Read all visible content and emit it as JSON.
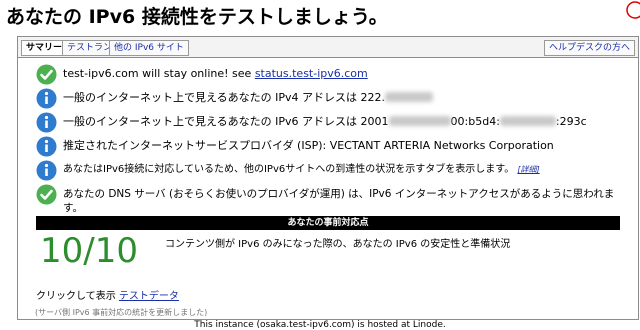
{
  "page_title": "あなたの IPv6 接続性をテストしましょう。",
  "colors": {
    "check_green": "#4caf50",
    "info_blue": "#2f7ccf",
    "score_green": "#2c8d2c",
    "link_blue": "#1a2ea8"
  },
  "tabs": [
    {
      "label": "サマリー",
      "active": true
    },
    {
      "label": "テストラン",
      "active": false
    },
    {
      "label": "他の IPv6 サイト",
      "active": false
    },
    {
      "label": "ヘルプデスクの方へ",
      "active": false
    }
  ],
  "results": [
    {
      "icon": "green-check-icon",
      "text": "test-ipv6.com will stay online! see ",
      "link": "status.test-ipv6.com"
    },
    {
      "icon": "blue-info-icon",
      "text": "一般のインターネット上で見えるあなたの IPv4 アドレスは 222."
    },
    {
      "icon": "blue-info-icon",
      "text": "一般のインターネット上で見えるあなたの IPv6 アドレスは 2001",
      "mid": "00:b5d4:",
      "tail": ":293c"
    },
    {
      "icon": "blue-info-icon",
      "text": "推定されたインターネットサービスプロバイダ (ISP): VECTANT ARTERIA Networks Corporation"
    },
    {
      "icon": "blue-info-icon",
      "text": "あなたはIPv6接続に対応しているため、他のIPv6サイトへの到達性の状況を示すタブを表示します。",
      "link": "[詳細]"
    },
    {
      "icon": "green-check-icon",
      "text": "あなたの DNS サーバ (おそらくお使いのプロバイダが運用) は、IPv6 インターネットアクセスがあるように思われま",
      "text2": "す。"
    }
  ],
  "readiness": {
    "header": "あなたの事前対応点",
    "score": "10/10",
    "description": "コンテンツ側が IPv6 のみになった際の、あなたの IPv6 の安定性と準備状況"
  },
  "test_data": {
    "prefix": "クリックして表示",
    "link": "テストデータ"
  },
  "stats_note": "(サーバ側 IPv6 事前対応の統計を更新しました)",
  "footer": "This instance (osaka.test-ipv6.com) is hosted at Linode."
}
